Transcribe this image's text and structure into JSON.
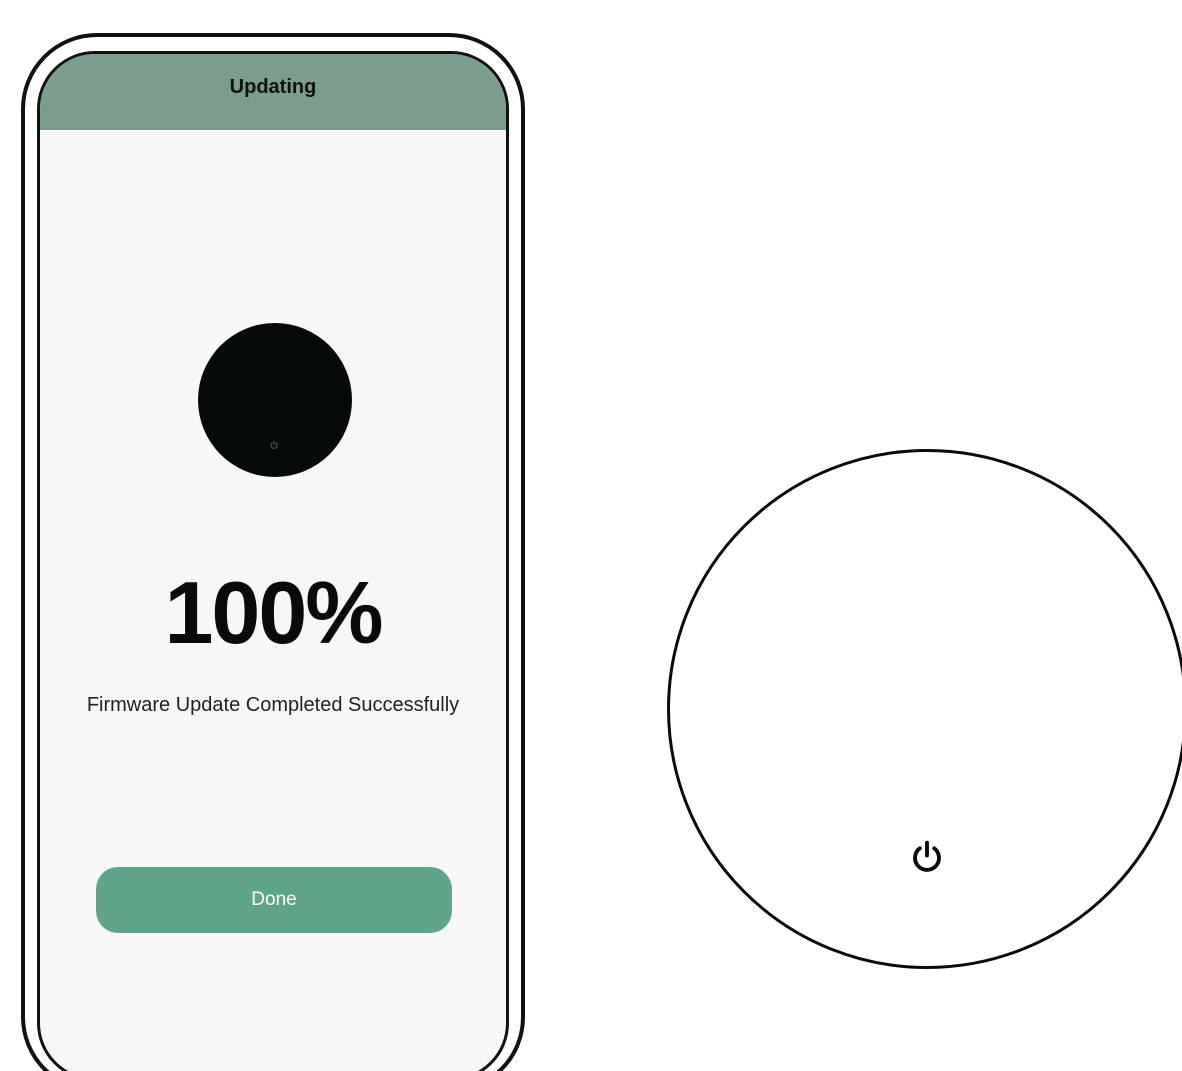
{
  "header": {
    "title": "Updating"
  },
  "progress": {
    "value_text": "100%",
    "value": 100,
    "status": "Firmware Update Completed Successfully"
  },
  "actions": {
    "done_label": "Done"
  },
  "icons": {
    "device_power": "power-icon",
    "large_device_power": "power-icon"
  },
  "colors": {
    "header_bg": "#7a9e8b",
    "button_bg": "#60a58a",
    "screen_bg": "#f7f7f7",
    "device_fill": "#060a0a"
  }
}
